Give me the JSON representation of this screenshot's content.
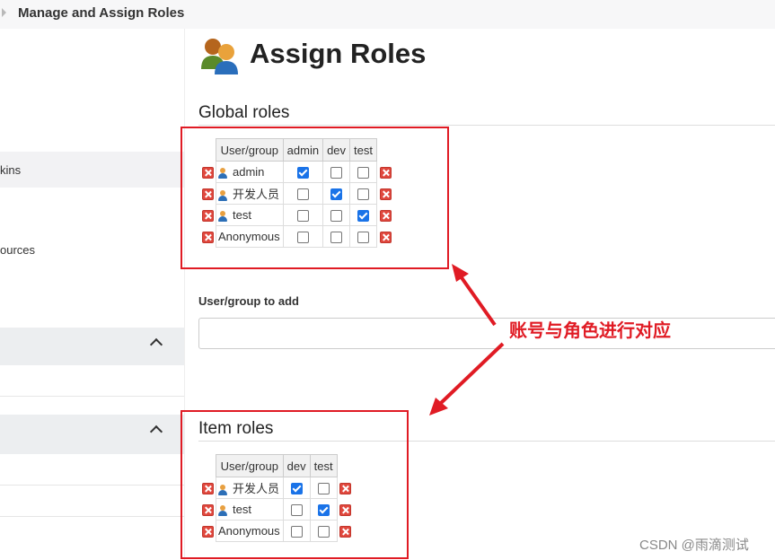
{
  "breadcrumb": {
    "current": "Manage and Assign Roles"
  },
  "sidebar": {
    "items": [
      {
        "label": "kins"
      },
      {
        "label": "ources"
      }
    ]
  },
  "page": {
    "title": "Assign Roles"
  },
  "global_roles": {
    "title": "Global roles",
    "header_user": "User/group",
    "columns": [
      "admin",
      "dev",
      "test"
    ],
    "rows": [
      {
        "name": "admin",
        "icon": "user-icon",
        "checks": [
          true,
          false,
          false
        ]
      },
      {
        "name": "开发人员",
        "icon": "user-icon",
        "checks": [
          false,
          true,
          false
        ]
      },
      {
        "name": "test",
        "icon": "user-icon",
        "checks": [
          false,
          false,
          true
        ]
      },
      {
        "name": "Anonymous",
        "icon": "",
        "checks": [
          false,
          false,
          false
        ]
      }
    ]
  },
  "add_user": {
    "label": "User/group to add",
    "value": ""
  },
  "item_roles": {
    "title": "Item roles",
    "header_user": "User/group",
    "columns": [
      "dev",
      "test"
    ],
    "rows": [
      {
        "name": "开发人员",
        "icon": "user-icon",
        "checks": [
          true,
          false
        ]
      },
      {
        "name": "test",
        "icon": "user-icon",
        "checks": [
          false,
          true
        ]
      },
      {
        "name": "Anonymous",
        "icon": "",
        "checks": [
          false,
          false
        ]
      }
    ]
  },
  "annotation": {
    "text": "账号与角色进行对应"
  },
  "watermark": {
    "text": "CSDN @雨滴测试"
  },
  "colors": {
    "annotation_red": "#e01b24",
    "checkbox_blue": "#1a73e8"
  }
}
